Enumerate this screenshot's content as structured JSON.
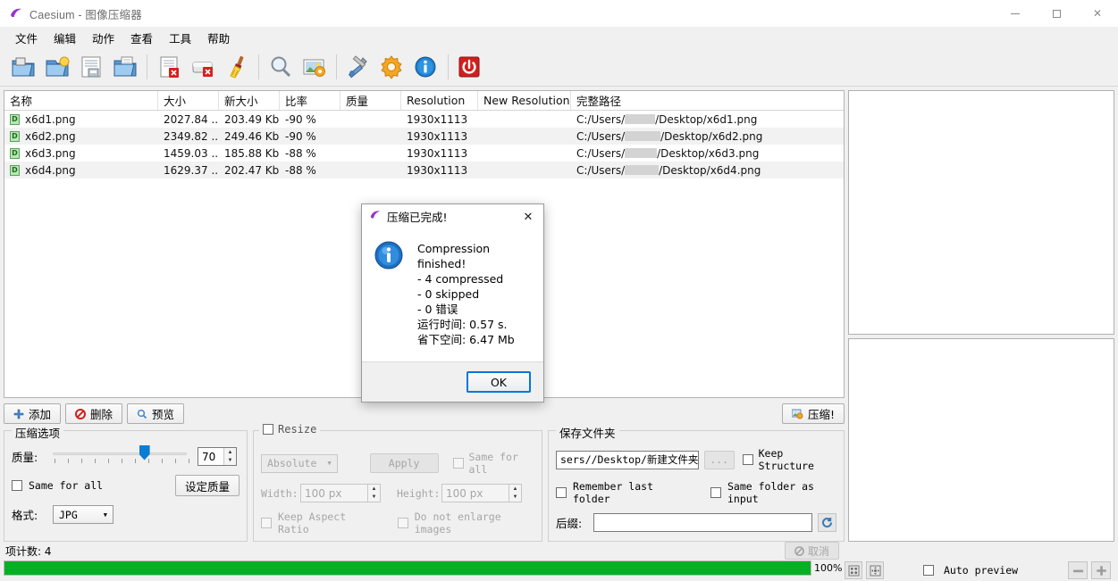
{
  "window": {
    "title": "Caesium - 图像压缩器",
    "controls": {
      "minimize": "minimize-icon",
      "maximize": "maximize-icon",
      "close": "close-icon"
    }
  },
  "menu": [
    {
      "label": "文件"
    },
    {
      "label": "编辑"
    },
    {
      "label": "动作"
    },
    {
      "label": "查看"
    },
    {
      "label": "工具"
    },
    {
      "label": "帮助"
    }
  ],
  "toolbar": [
    {
      "name": "open-folder-icon",
      "group": 1
    },
    {
      "name": "add-folder-icon",
      "group": 1
    },
    {
      "name": "save-list-icon",
      "group": 1
    },
    {
      "name": "open-list-icon",
      "group": 1
    },
    {
      "name": "remove-item-icon",
      "group": 2
    },
    {
      "name": "clear-list-icon",
      "group": 2
    },
    {
      "name": "broom-clean-icon",
      "group": 2
    },
    {
      "name": "preview-zoom-icon",
      "group": 3
    },
    {
      "name": "compress-image-icon",
      "group": 3
    },
    {
      "name": "tools-settings-icon",
      "group": 4
    },
    {
      "name": "options-gear-icon",
      "group": 4
    },
    {
      "name": "info-icon",
      "group": 4
    },
    {
      "name": "exit-power-icon",
      "group": 5
    }
  ],
  "filelist": {
    "columns": [
      "名称",
      "大小",
      "新大小",
      "比率",
      "质量",
      "Resolution",
      "New Resolution",
      "完整路径"
    ],
    "rows": [
      {
        "name": "x6d1.png",
        "size": "2027.84 ...",
        "new_size": "203.49 Kb",
        "ratio": "-90 %",
        "quality": "",
        "resolution": "1930x1113",
        "new_resolution": "",
        "path_prefix": "C:/Users/",
        "path_suffix": "/Desktop/x6d1.png"
      },
      {
        "name": "x6d2.png",
        "size": "2349.82 ...",
        "new_size": "249.46 Kb",
        "ratio": "-90 %",
        "quality": "",
        "resolution": "1930x1113",
        "new_resolution": "",
        "path_prefix": "C:/Users/",
        "path_suffix": "/Desktop/x6d2.png"
      },
      {
        "name": "x6d3.png",
        "size": "1459.03 ...",
        "new_size": "185.88 Kb",
        "ratio": "-88 %",
        "quality": "",
        "resolution": "1930x1113",
        "new_resolution": "",
        "path_prefix": "C:/Users/",
        "path_suffix": "/Desktop/x6d3.png"
      },
      {
        "name": "x6d4.png",
        "size": "1629.37 ...",
        "new_size": "202.47 Kb",
        "ratio": "-88 %",
        "quality": "",
        "resolution": "1930x1113",
        "new_resolution": "",
        "path_prefix": "C:/Users/",
        "path_suffix": "/Desktop/x6d4.png"
      }
    ]
  },
  "actions": {
    "add": "添加",
    "remove": "删除",
    "preview": "预览",
    "compress": "压缩!"
  },
  "compression_panel": {
    "legend": "压缩选项",
    "quality_label": "质量:",
    "quality_value": "70",
    "same_for_all_label": "Same for all",
    "same_for_all_checked": false,
    "set_quality_button": "设定质量",
    "format_label": "格式:",
    "format_value": "JPG"
  },
  "resize_panel": {
    "legend": "Resize",
    "enabled": false,
    "mode_value": "Absolute",
    "apply_button": "Apply",
    "same_for_all_label": "Same for all",
    "same_for_all_checked": false,
    "width_label": "Width:",
    "width_value": "100 px",
    "height_label": "Height:",
    "height_value": "100 px",
    "keep_aspect_label": "Keep Aspect Ratio",
    "keep_aspect_checked": false,
    "do_not_enlarge_label": "Do not enlarge images",
    "do_not_enlarge_checked": false
  },
  "output_panel": {
    "legend": "保存文件夹",
    "path_prefix": "sers/",
    "path_suffix": "/Desktop/新建文件夹",
    "browse_button": "...",
    "keep_structure_label": "Keep Structure",
    "keep_structure_checked": false,
    "remember_last_folder_label": "Remember last folder",
    "remember_last_folder_checked": false,
    "same_folder_as_input_label": "Same folder as input",
    "same_folder_as_input_checked": false,
    "suffix_label": "后缀:",
    "suffix_value": "",
    "reset_icon": "refresh-icon"
  },
  "preview": {
    "fit_icon": "fit-grid-icon",
    "expand_icon": "expand-arrows-icon",
    "auto_preview_label": "Auto preview",
    "auto_preview_checked": false,
    "zoom_out_icon": "zoom-out-icon",
    "zoom_in_icon": "zoom-in-icon"
  },
  "status": {
    "item_count": "项计数: 4",
    "cancel_button": "取消",
    "cancel_enabled": false,
    "progress_percent": "100%",
    "progress_value": 100,
    "progress_color": "#06b025"
  },
  "dialog": {
    "title": "压缩已完成!",
    "icon": "info-icon",
    "lines": [
      "Compression finished!",
      "- 4 compressed",
      "- 0 skipped",
      "- 0 错误",
      "运行时间: 0.57 s.",
      "省下空间: 6.47 Mb"
    ],
    "ok_button": "OK"
  },
  "colors": {
    "accent": "#0078d7",
    "progress_green": "#06b025",
    "slider_blue": "#0a7cd4",
    "window_bg": "#f0f0f0"
  }
}
